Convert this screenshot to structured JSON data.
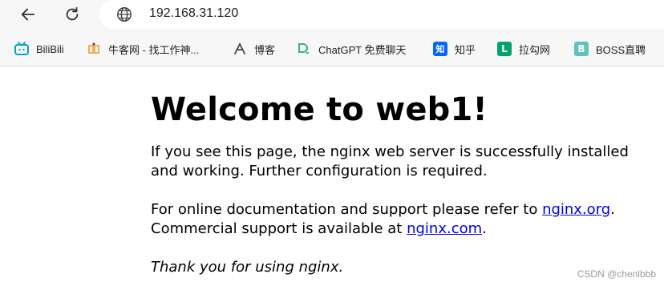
{
  "browser": {
    "url": "192.168.31.120",
    "bookmarks": [
      {
        "label": "BiliBili",
        "icon": "bilibili-icon",
        "color": "#00a1d6"
      },
      {
        "label": "牛客网 - 找工作神...",
        "icon": "nowcoder-icon",
        "color": "#f3a640"
      },
      {
        "label": "博客",
        "icon": "blog-icon",
        "color": "#444444"
      },
      {
        "label": "ChatGPT 免费聊天",
        "icon": "chatgpt-icon",
        "color": "#3cb371"
      },
      {
        "label": "知乎",
        "icon": "zhihu-icon",
        "color": "#0066ff",
        "glyph": "知"
      },
      {
        "label": "拉勾网",
        "icon": "lagou-icon",
        "color": "#00a36c",
        "glyph": "L"
      },
      {
        "label": "BOSS直聘",
        "icon": "boss-icon",
        "color": "#5dc2c0",
        "glyph": "B"
      }
    ]
  },
  "page": {
    "heading": "Welcome to web1!",
    "para1": "If you see this page, the nginx web server is successfully installed and working. Further configuration is required.",
    "para2_prefix": "For online documentation and support please refer to ",
    "link1": "nginx.org",
    "para2_mid": ".",
    "para2_line2": "Commercial support is available at ",
    "link2": "nginx.com",
    "para2_end": ".",
    "thanks": "Thank you for using nginx."
  },
  "watermark": "CSDN @chenlbbb"
}
